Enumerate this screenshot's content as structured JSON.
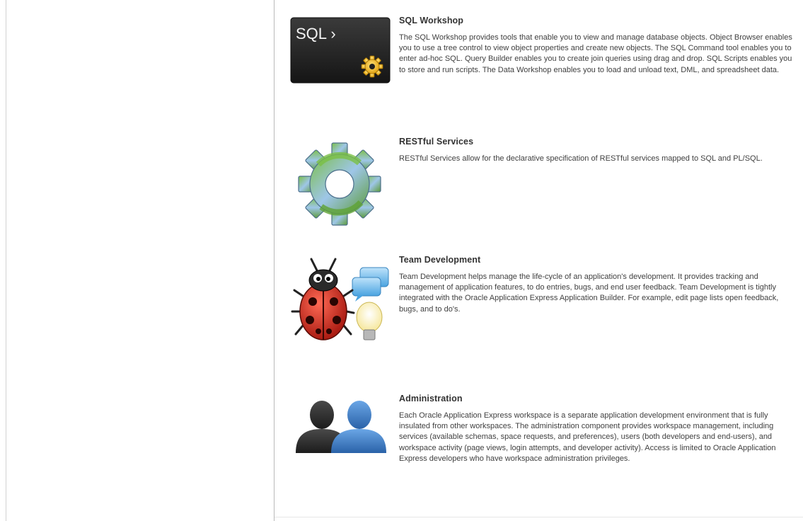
{
  "features": [
    {
      "title": "SQL Workshop",
      "icon_name": "sql-workshop-icon",
      "icon_text": "SQL ›",
      "description": "The SQL Workshop provides tools that enable you to view and manage database objects. Object Browser enables you to use a tree control to view object properties and create new objects. The SQL Command tool enables you to enter ad-hoc SQL. Query Builder enables you to create join queries using drag and drop. SQL Scripts enables you to store and run scripts. The Data Workshop enables you to load and unload text, DML, and spreadsheet data."
    },
    {
      "title": "RESTful Services",
      "icon_name": "restful-services-gear-icon",
      "description": "RESTful Services allow for the declarative specification of RESTful services mapped to SQL and PL/SQL."
    },
    {
      "title": "Team Development",
      "icon_name": "team-development-icon",
      "description": "Team Development helps manage the life-cycle of an application's development. It provides tracking and management of application features, to do entries, bugs, and end user feedback. Team Development is tightly integrated with the Oracle Application Express Application Builder. For example, edit page lists open feedback, bugs, and to do's."
    },
    {
      "title": "Administration",
      "icon_name": "administration-users-icon",
      "description": "Each Oracle Application Express workspace is a separate application development environment that is fully insulated from other workspaces. The administration component provides workspace management, including services (available schemas, space requests, and preferences), users (both developers and end-users), and workspace activity (page views, login attempts, and developer activity). Access is limited to Oracle Application Express developers who have workspace administration privileges."
    }
  ],
  "colors": {
    "title": "#333333",
    "body_text": "#404040",
    "divider": "#b9b9b9",
    "sql_tile": "#1f1f1f",
    "gear_green": "#6aa83a",
    "gear_blue": "#8fb3d9",
    "bug_red": "#c8281e",
    "admin_blue": "#3a78c0",
    "admin_dark": "#2b2b2b"
  }
}
